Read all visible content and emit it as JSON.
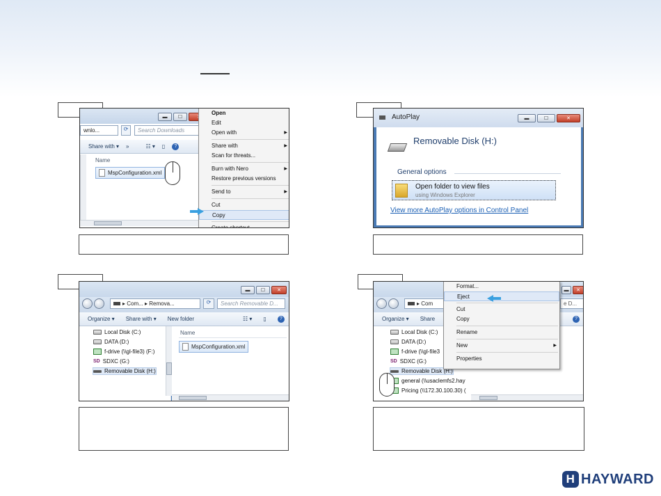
{
  "shot1": {
    "address_fragment": "wnlo...",
    "search_placeholder": "Search Downloads",
    "share_with": "Share with ▾",
    "more": "»",
    "column_name": "Name",
    "file_name": "MspConfiguration.xml",
    "context_menu": [
      {
        "label": "Open",
        "bold": true
      },
      {
        "label": "Edit"
      },
      {
        "label": "Open with",
        "submenu": true
      },
      {
        "sep": true
      },
      {
        "label": "Share with",
        "submenu": true
      },
      {
        "label": "Scan for threats..."
      },
      {
        "sep": true
      },
      {
        "label": "Burn with Nero",
        "submenu": true
      },
      {
        "label": "Restore previous versions"
      },
      {
        "sep": true
      },
      {
        "label": "Send to",
        "submenu": true
      },
      {
        "sep": true
      },
      {
        "label": "Cut"
      },
      {
        "label": "Copy",
        "highlight": true
      },
      {
        "sep": true
      },
      {
        "label": "Create shortcut"
      }
    ]
  },
  "shot2": {
    "window_title": "AutoPlay",
    "drive_name": "Removable Disk (H:)",
    "section": "General options",
    "option_title": "Open folder to view files",
    "option_sub": "using Windows Explorer",
    "link": "View more AutoPlay options in Control Panel"
  },
  "shot3": {
    "address": "▸ Com... ▸ Remova...",
    "search_placeholder": "Search Removable D...",
    "toolbar": [
      "Organize ▾",
      "Share with ▾",
      "New folder"
    ],
    "tree": [
      {
        "label": "Local Disk (C:)",
        "icon": "local-disk"
      },
      {
        "label": "DATA (D:)",
        "icon": "drive"
      },
      {
        "label": "f-drive (\\\\gl-file3) (F:)",
        "icon": "network-drive"
      },
      {
        "label": "SDXC (G:)",
        "icon": "sd-card"
      },
      {
        "label": "Removable Disk (H:)",
        "icon": "removable",
        "selected": true
      }
    ],
    "column_name": "Name",
    "file_name": "MspConfiguration.xml"
  },
  "shot4": {
    "address_fragment": "▸ Com",
    "search_fragment": "e D...",
    "toolbar": [
      "Organize ▾",
      "Share"
    ],
    "tree": [
      {
        "label": "Local Disk (C:)",
        "icon": "local-disk"
      },
      {
        "label": "DATA (D:)",
        "icon": "drive"
      },
      {
        "label": "f-drive (\\\\gl-file3",
        "icon": "network-drive"
      },
      {
        "label": "SDXC (G:)",
        "icon": "sd-card"
      },
      {
        "label": "Removable Disk (H:)",
        "icon": "removable",
        "selected": true
      },
      {
        "label": "general (\\\\usaclemfs2.hay",
        "icon": "network-drive"
      },
      {
        "label": "Pricing (\\\\172.30.100.30) (",
        "icon": "network-drive"
      }
    ],
    "context_menu": [
      {
        "label": "Format..."
      },
      {
        "label": "Eject",
        "highlight": true
      },
      {
        "sep": true
      },
      {
        "label": "Cut"
      },
      {
        "label": "Copy"
      },
      {
        "sep": true
      },
      {
        "label": "Rename"
      },
      {
        "sep": true
      },
      {
        "label": "New",
        "submenu": true
      },
      {
        "sep": true
      },
      {
        "label": "Properties"
      }
    ]
  },
  "logo": "HAYWARD",
  "colors": {
    "logo": "#1f3e7a",
    "arrow": "#3aa0e0",
    "highlight": "#dfe9f7"
  }
}
